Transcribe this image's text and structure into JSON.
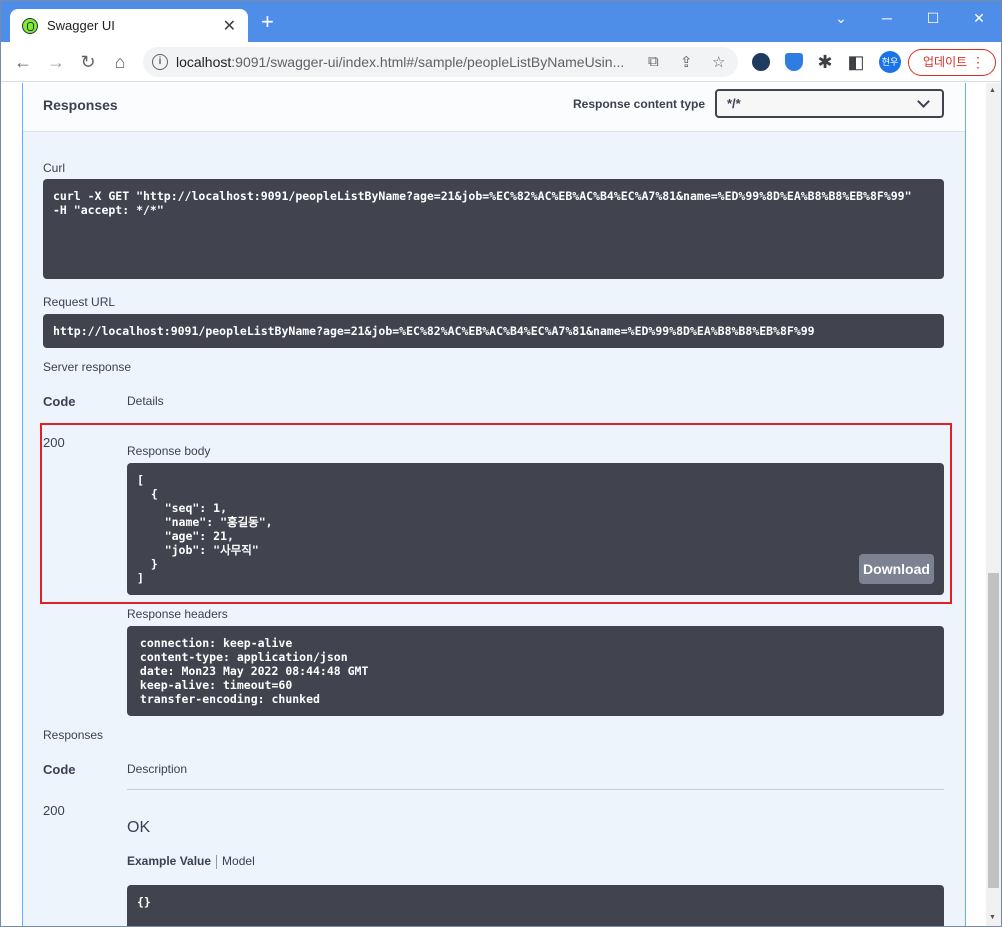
{
  "browser": {
    "tab_title": "Swagger UI",
    "tab_close": "✕",
    "new_tab": "+",
    "url_host": "localhost",
    "url_rest": ":9091/swagger-ui/index.html#/sample/peopleListByNameUsin...",
    "profile_label": "현우",
    "update_label": "업데이트",
    "window_controls": [
      "─",
      "☐",
      "✕"
    ]
  },
  "responses_header": {
    "title": "Responses",
    "content_type_label": "Response content type",
    "content_type_value": "*/*"
  },
  "curl": {
    "label": "Curl",
    "command": "curl -X GET \"http://localhost:9091/peopleListByName?age=21&job=%EC%82%AC%EB%AC%B4%EC%A7%81&name=%ED%99%8D%EA%B8%B8%EB%8F%99\"\n-H \"accept: */*\""
  },
  "request_url": {
    "label": "Request URL",
    "value": "http://localhost:9091/peopleListByName?age=21&job=%EC%82%AC%EB%AC%B4%EC%A7%81&name=%ED%99%8D%EA%B8%B8%EB%8F%99"
  },
  "server_response": {
    "label": "Server response",
    "col_code": "Code",
    "col_details": "Details",
    "code": "200",
    "body_label": "Response body",
    "body": "[\n  {\n    \"seq\": 1,\n    \"name\": \"홍길동\",\n    \"age\": 21,\n    \"job\": \"사무직\"\n  }\n]",
    "download_label": "Download",
    "headers_label": "Response headers",
    "headers": " connection: keep-alive\n content-type: application/json\n date: Mon23 May 2022 08:44:48 GMT\n keep-alive: timeout=60\n transfer-encoding: chunked"
  },
  "responses": {
    "label": "Responses",
    "col_code": "Code",
    "col_description": "Description",
    "code": "200",
    "description": "OK",
    "example_value_tab": "Example Value",
    "model_tab": "Model",
    "example": "{}"
  }
}
